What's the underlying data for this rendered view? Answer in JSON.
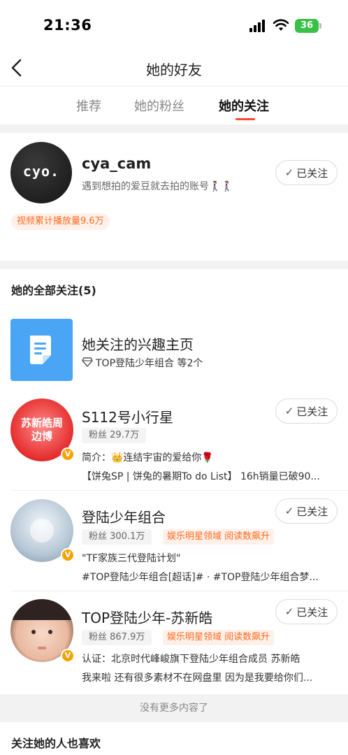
{
  "status_bar": {
    "time": "21:36",
    "battery": "36"
  },
  "header": {
    "title": "她的好友"
  },
  "tabs": [
    {
      "label": "推荐"
    },
    {
      "label": "她的粉丝"
    },
    {
      "label": "她的关注"
    }
  ],
  "profile_card": {
    "avatar_text": "cyo.",
    "name": "cya_cam",
    "bio": "遇到想拍的爱豆就去拍的账号🚶‍♀️🚶‍♀️",
    "stat_tag": "视频累计播放量9.6万",
    "follow_label": "已关注"
  },
  "following": {
    "heading": "她的全部关注(5)",
    "interest": {
      "title": "她关注的兴趣主页",
      "subtitle": "TOP登陆少年组合 等2个"
    },
    "items": [
      {
        "name": "S112号小行星",
        "fans": "粉丝 29.7万",
        "tags": [],
        "line1": "简介：👑连结宇宙的爱给你🌹",
        "line2": "【饼兔SP | 饼兔的暑期To do List】 16h销量已破90...",
        "avatar_text": "苏新皓周边博",
        "follow_label": "已关注"
      },
      {
        "name": "登陆少年组合",
        "fans": "粉丝 300.1万",
        "tags": [
          "娱乐明星领域 阅读数飙升"
        ],
        "line1": "\"TF家族三代登陆计划\"",
        "line2": "#TOP登陆少年组合[超话]# · #TOP登陆少年组合梦...",
        "avatar_text": "",
        "follow_label": "已关注"
      },
      {
        "name": "TOP登陆少年-苏新皓",
        "fans": "粉丝 867.9万",
        "tags": [
          "娱乐明星领域 阅读数飙升"
        ],
        "line1": "认证：北京时代峰峻旗下登陆少年组合成员 苏新皓",
        "line2": "我来啦 还有很多素材不在网盘里 因为是我要给你们...",
        "avatar_text": "",
        "follow_label": "已关注"
      }
    ]
  },
  "footer": {
    "no_more": "没有更多内容了",
    "recommend_heading": "关注她的人也喜欢"
  },
  "colors": {
    "accent": "#ff4a2a",
    "tag_orange": "#ff6a1f",
    "interest_blue": "#4aa5f5"
  }
}
